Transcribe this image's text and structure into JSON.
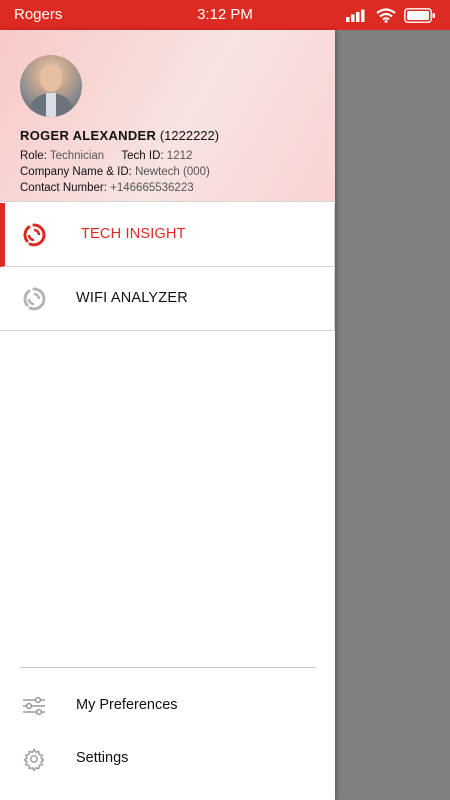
{
  "status_bar": {
    "carrier": "Rogers",
    "time": "3:12 PM",
    "icons": [
      "signal-icon",
      "wifi-icon",
      "battery-icon"
    ]
  },
  "profile": {
    "name": "ROGER ALEXANDER",
    "id": "(1222222)",
    "role_label": "Role:",
    "role_value": "Technician",
    "tech_id_label": "Tech ID:",
    "tech_id_value": "1212",
    "company_label": "Company Name & ID:",
    "company_value": "Newtech (000)",
    "contact_label": "Contact Number:",
    "contact_value": "+146665536223"
  },
  "menu": {
    "items": [
      {
        "label": "TECH INSIGHT",
        "icon": "tech-insight-logo-icon",
        "active": true
      },
      {
        "label": "WIFI ANALYZER",
        "icon": "wifi-analyzer-logo-icon",
        "active": false
      }
    ]
  },
  "footer": {
    "preferences_label": "My Preferences",
    "settings_label": "Settings"
  },
  "colors": {
    "accent": "#dd2a22",
    "overlay": "#808080",
    "inactive_icon": "#b5b5b5"
  }
}
